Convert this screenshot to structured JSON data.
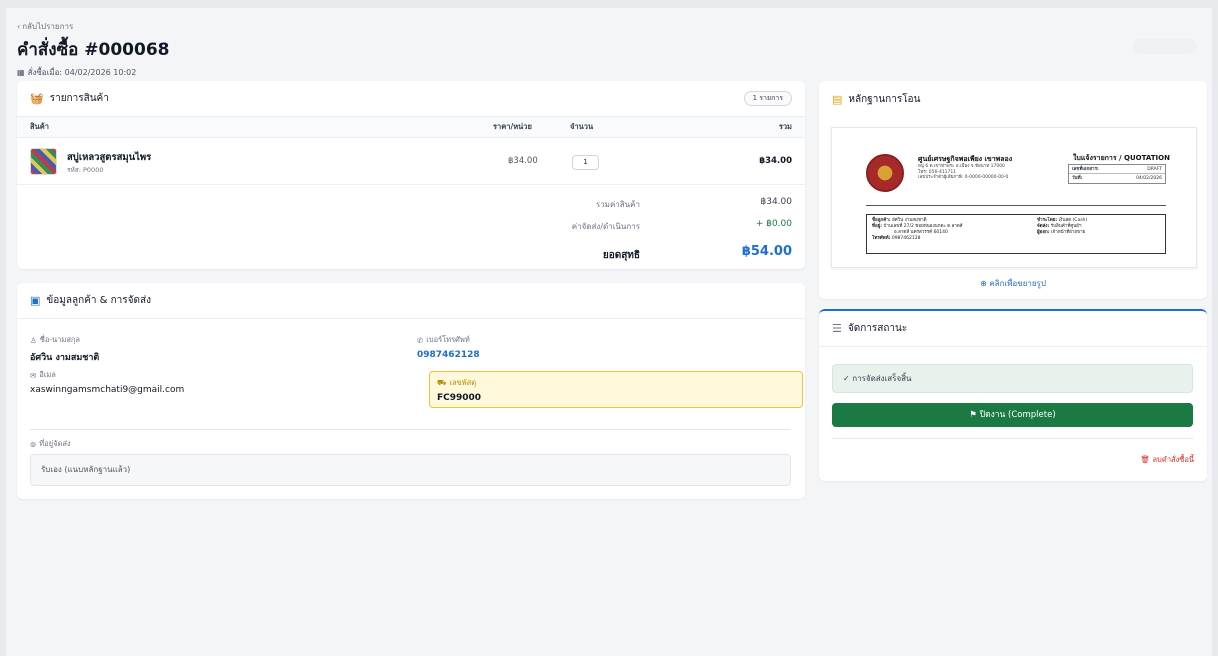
{
  "header": {
    "back_label": "กลับไปรายการ",
    "title": "คำสั่งซื้อ #000068",
    "ordered_at": "สั่งซื้อเมื่อ: 04/02/2026 10:02"
  },
  "items_card": {
    "title": "รายการสินค้า",
    "count_badge": "1 รายการ",
    "columns": [
      "สินค้า",
      "ราคา/หน่วย",
      "จำนวน",
      "รวม"
    ],
    "rows": [
      {
        "name": "สบู่เหลวสูตรสมุนไพร",
        "code": "รหัส: P0000",
        "unit_price": "฿34.00",
        "qty": "1",
        "total": "฿34.00"
      }
    ],
    "subtotal_label": "รวมค่าสินค้า",
    "subtotal": "฿34.00",
    "shipping_label": "ค่าจัดส่ง/ดำเนินการ",
    "shipping": "+ ฿0.00",
    "net_label": "ยอดสุทธิ",
    "net": "฿54.00"
  },
  "customer_card": {
    "title": "ข้อมูลลูกค้า & การจัดส่ง",
    "name_label": "ชื่อ-นามสกุล",
    "name": "อัศวิน งามสมชาติ",
    "phone_label": "เบอร์โทรศัพท์",
    "phone": "0987462128",
    "email_label": "อีเมล",
    "email": "xaswinngamsmchati9@gmail.com",
    "tracking_label": "เลขพัสดุ",
    "tracking": "FC99000",
    "address_label": "ที่อยู่จัดส่ง",
    "address": "รับเอง (แนบหลักฐานแล้ว)"
  },
  "evidence_card": {
    "title": "หลักฐานการโอน",
    "doc": {
      "org": "ศูนย์เศรษฐกิจพอเพียง เขาพลอง",
      "org_addr": "หมู่ 6 ต.เขาท่าพระ อ.เมือง จ.ชัยนาท 17000",
      "org_tel": "โทร: 056-411711",
      "org_tax": "เลขประจำตัวผู้เสียภาษี: 0-0000-00000-00-0",
      "doc_title": "ใบแจ้งรายการ / QUOTATION",
      "doc_no_label": "เลขที่เอกสาร:",
      "doc_no": "DRAFT",
      "doc_date_label": "วันที่:",
      "doc_date": "04/02/2026",
      "cust_name_label": "ชื่อลูกค้า:",
      "cust_name": "อัศวิน งามสมชาติ",
      "cust_addr_label": "ที่อยู่:",
      "cust_addr": "บ้านเลขที่ 27/2 ชอยหนองนกตะ ต.ลาดสี",
      "cust_addr2": "อ.ลาดสี นครสวรรค์ 60140",
      "cust_tel_label": "โทรศัพท์:",
      "cust_tel": "0987462128",
      "pay_label": "ชำระโดย:",
      "pay": "เงินสด (Cash)",
      "ship_label": "จัดส่ง:",
      "ship": "รับสินค้าที่ศูนย์ฯ",
      "seller_label": "ผู้ออก:",
      "seller": "เจ้าหน้าที่ฝ่ายขาย"
    },
    "zoom_label": "คลิกเพื่อขยายรูป"
  },
  "status_card": {
    "title": "จัดการสถานะ",
    "done_text": "การจัดส่งเสร็จสิ้น",
    "close_button": "ปิดงาน (Complete)",
    "delete_button": "ลบคำสั่งซื้อนี้"
  },
  "colors": {
    "accent": "#1d6fcc",
    "success": "#1b7a43",
    "danger": "#dc2626",
    "warning_bg": "#fff8db"
  }
}
